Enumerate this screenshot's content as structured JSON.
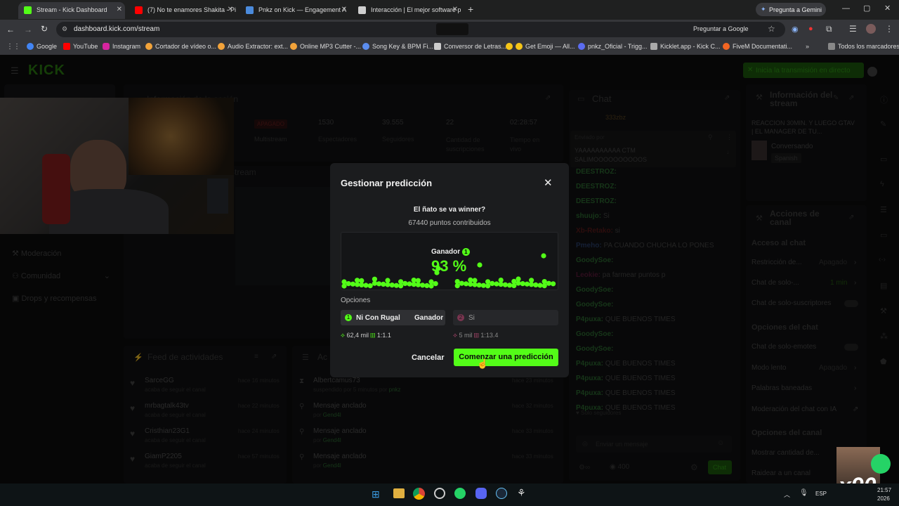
{
  "tabs": [
    {
      "label": "Stream - Kick Dashboard",
      "active": true,
      "color": "#53fc18"
    },
    {
      "label": "(7) No te enamores Shakita - Pi",
      "active": false,
      "color": "#ff0000"
    },
    {
      "label": "Pnkz on Kick — Engagement A",
      "active": false,
      "color": "#4b8bdc"
    },
    {
      "label": "Interacción | El mejor software p",
      "active": false,
      "color": "#cfcfcf"
    }
  ],
  "gemini_label": "Pregunta a Gemini",
  "url": "dashboard.kick.com/stream",
  "ask_google": "Preguntar a Google",
  "bookmarks": [
    "Google",
    "YouTube",
    "Instagram",
    "Cortador de vídeo o...",
    "Audio Extractor: ext...",
    "Online MP3 Cutter -...",
    "Song Key & BPM Fi...",
    "Conversor de Letras...",
    "Get Emoji — All...",
    "pnkz_Oficial - Trigg...",
    "Kicklet.app - Kick C...",
    "FiveM Documentati..."
  ],
  "bookmarks_all": "Todos los marcadores",
  "kick_logo": "KICK",
  "start_stream": "Inicia la transmisión en directo",
  "session": {
    "title": "Información de la sesión",
    "status": "APAGADO",
    "stats": [
      {
        "value": "1530",
        "label": "Espectadores"
      },
      {
        "value": "39.555",
        "label": "Seguidores"
      },
      {
        "value": "22",
        "label": "Cantidad de suscripciones"
      },
      {
        "value": "02:28:57",
        "label": "Tiempo en vivo"
      }
    ],
    "multistream": "Multistream"
  },
  "sidebar": [
    "Moderación",
    "Comunidad",
    "Drops y recompensas"
  ],
  "stream_label": "Stream",
  "feed": {
    "title": "Feed de actividades",
    "items": [
      {
        "name": "SarceGG",
        "sub": "acaba de seguir el canal",
        "time": "hace 16 minutos"
      },
      {
        "name": "mrbagtalk43tv",
        "sub": "acaba de seguir el canal",
        "time": "hace 22 minutos"
      },
      {
        "name": "Cristhian23G1",
        "sub": "acaba de seguir el canal",
        "time": "hace 24 minutos"
      },
      {
        "name": "GiamP2205",
        "sub": "acaba de seguir el canal",
        "time": "hace 57 minutos"
      }
    ]
  },
  "actions_feed": {
    "title": "Ac",
    "items": [
      {
        "name": "Albertcamus73",
        "sub": "suspendido por 5 minutos por",
        "by": "pnkz",
        "time": "hace 23 minutos"
      },
      {
        "name": "Mensaje anclado",
        "sub": "por",
        "by": "Gend4l",
        "time": "hace 32 minutos"
      },
      {
        "name": "Mensaje anclado",
        "sub": "por",
        "by": "Gend4l",
        "time": "hace 33 minutos"
      },
      {
        "name": "Mensaje anclado",
        "sub": "por",
        "by": "Gend4l",
        "time": "hace 33 minutos"
      }
    ]
  },
  "chat": {
    "title": "Chat",
    "top_user": "333zbz",
    "pinned_by": "Enviado por",
    "pinned_msg": "YAAAAAAAAAA CTM SALIMOOOOOOOOOOS",
    "lines": [
      {
        "user": "DEESTROZ:",
        "msg": ""
      },
      {
        "user": "DEESTROZ:",
        "msg": ""
      },
      {
        "user": "DEESTROZ:",
        "msg": ""
      },
      {
        "user": "shuujo:",
        "msg": "Si"
      },
      {
        "user": "Xb-Retako:",
        "msg": "si"
      },
      {
        "user": "Pmeho:",
        "msg": "PA CUANDO CHUCHA LO PONES"
      },
      {
        "user": "GoodySoe:",
        "msg": ""
      },
      {
        "user": "Leokie:",
        "msg": "pa farmear puntos p"
      },
      {
        "user": "GoodySoe:",
        "msg": ""
      },
      {
        "user": "GoodySoe:",
        "msg": ""
      },
      {
        "user": "P4puxa:",
        "msg": "QUE BUENOS TIMES"
      },
      {
        "user": "GoodySoe:",
        "msg": ""
      },
      {
        "user": "GoodySoe:",
        "msg": ""
      },
      {
        "user": "P4puxa:",
        "msg": "QUE BUENOS TIMES"
      },
      {
        "user": "P4puxa:",
        "msg": "QUE BUENOS TIMES"
      },
      {
        "user": "P4puxa:",
        "msg": "QUE BUENOS TIMES"
      },
      {
        "user": "P4puxa:",
        "msg": "QUE BUENOS TIMES"
      }
    ],
    "followers_only": "Solo seguidores",
    "placeholder": "Enviar un mensaje",
    "points": "400",
    "send": "Chat"
  },
  "stream_info": {
    "title": "Información del stream",
    "stream_title": "REACCION 30MIN. Y LUEGO GTAV | EL MANAGER DE TU...",
    "category": "Conversando",
    "language": "Spanish"
  },
  "channel_actions": {
    "title": "Acciones de canal",
    "chat_access": "Acceso al chat",
    "restriction": "Restricción de...",
    "restriction_val": "Apagado",
    "solo_chat": "Chat de solo-...",
    "solo_chat_val": "1 min",
    "subs_only": "Chat de solo-suscriptores",
    "chat_options": "Opciones del chat",
    "emote_only": "Chat de solo-emotes",
    "slow_mode": "Modo lento",
    "slow_mode_val": "Apagado",
    "banned_words": "Palabras baneadas",
    "ai_mod": "Moderación del chat con IA",
    "channel_options": "Opciones del canal",
    "show_count": "Mostrar cantidad de...",
    "raid": "Raidear a un canal"
  },
  "modal": {
    "title": "Gestionar predicción",
    "question": "El ñato se va winner?",
    "points": "67440 puntos contribuidos",
    "winner_label": "Ganador",
    "winner_num": "1",
    "percent": "93 %",
    "percent_value": 93,
    "options_label": "Opciones",
    "option1": {
      "num": "1",
      "label": "Ni Con Rugal",
      "tag": "Ganador",
      "points": "62,4 mil",
      "ratio": "1:1.1"
    },
    "option2": {
      "num": "2",
      "label": "Si",
      "points": "5 mil",
      "ratio": "1:13.4"
    },
    "cancel": "Cancelar",
    "start": "Comenzar una predicción"
  },
  "overlay_text": "x90",
  "taskbar": {
    "lang": "ESP",
    "time": "21:57",
    "date": "2026"
  },
  "colors": {
    "kick_green": "#53fc18",
    "panel": "#1b1c1e",
    "dark": "#0c0c0d"
  }
}
